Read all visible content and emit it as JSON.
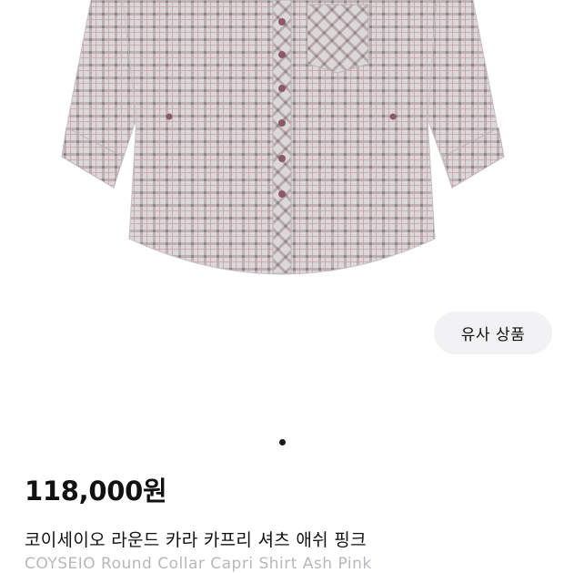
{
  "product": {
    "image_icon": "plaid-shirt-photo",
    "similar_button_label": "유사 상품",
    "pager": {
      "count": 1,
      "active_index": 0
    },
    "price": "118,000원",
    "title_ko": "코이세이오 라운드 카라 카프리 셔츠 애쉬 핑크",
    "title_en": "COYSEIO Round Collar Capri Shirt Ash Pink"
  },
  "colors": {
    "shirt_base": "#d9d5d6",
    "shirt_check": "#a89a9c",
    "shirt_accent": "#b07f88",
    "button_bg": "#f2f2f4",
    "secondary_text": "#b8b8bc"
  }
}
